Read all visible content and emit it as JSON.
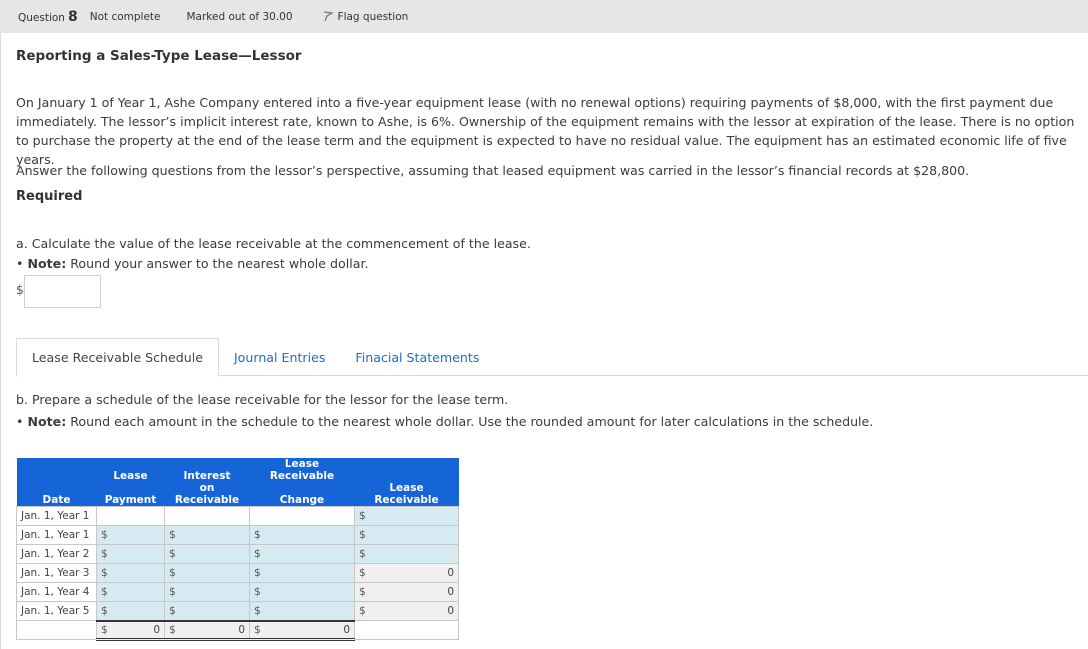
{
  "question_bar": {
    "question_label": "Question",
    "question_number": "8",
    "status": "Not complete",
    "marks": "Marked out of 30.00",
    "flag_label": "Flag question"
  },
  "title": "Reporting a Sales-Type Lease—Lessor",
  "paragraphs": [
    "On January 1 of Year 1, Ashe Company entered into a five-year equipment lease (with no renewal options) requiring payments of $8,000, with the first payment due immediately. The lessor’s implicit interest rate, known to Ashe, is 6%. Ownership of the equipment remains with the lessor at expiration of the lease. There is no option to purchase the property at the end of the lease term and the equipment is expected to have no residual value. The equipment has an estimated economic life of five years.",
    "Answer the following questions from the lessor’s perspective, assuming that leased equipment was carried in the lessor’s financial records at $28,800."
  ],
  "required_label": "Required",
  "part_a": {
    "prompt": "a. Calculate the value of the lease receivable at the commencement of the lease.",
    "note_bullet": "• ",
    "note_label": "Note:",
    "note_text": " Round your answer to the nearest whole dollar.",
    "currency": "$",
    "answer_value": ""
  },
  "tabs": [
    {
      "label": "Lease Receivable Schedule",
      "active": true
    },
    {
      "label": "Journal Entries",
      "active": false
    },
    {
      "label": "Finacial Statements",
      "active": false
    }
  ],
  "part_b": {
    "prompt": "b. Prepare a schedule of the lease receivable for the lessor for the lease term.",
    "note_bullet": "• ",
    "note_label": "Note:",
    "note_text": " Round each amount in the schedule to the nearest whole dollar. Use the rounded amount for later calculations in the schedule."
  },
  "schedule": {
    "headers_top": [
      "",
      "Lease",
      "Interest",
      "Lease Receivable",
      ""
    ],
    "headers_bottom": [
      "Date",
      "Payment",
      "on Receivable",
      "Change",
      "Lease Receivable"
    ],
    "currency": "$",
    "initial_row": {
      "date": "Jan. 1, Year 1",
      "receivable": ""
    },
    "rows": [
      {
        "date": "Jan. 1, Year 1",
        "payment": "",
        "interest": "",
        "change": "",
        "receivable": ""
      },
      {
        "date": "Jan. 1, Year 2",
        "payment": "",
        "interest": "",
        "change": "",
        "receivable": ""
      },
      {
        "date": "Jan. 1, Year 3",
        "payment": "",
        "interest": "",
        "change": "",
        "receivable": "0"
      },
      {
        "date": "Jan. 1, Year 4",
        "payment": "",
        "interest": "",
        "change": "",
        "receivable": "0"
      },
      {
        "date": "Jan. 1, Year 5",
        "payment": "",
        "interest": "",
        "change": "",
        "receivable": "0"
      }
    ],
    "totals": {
      "payment": "0",
      "interest": "0",
      "change": "0"
    }
  }
}
